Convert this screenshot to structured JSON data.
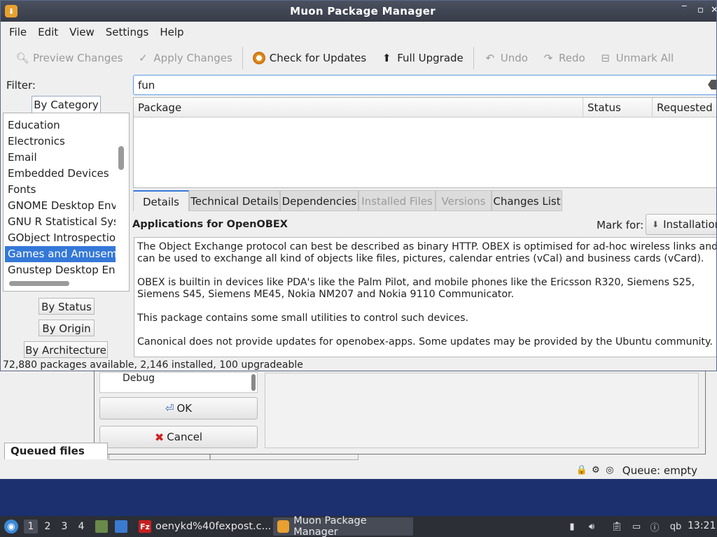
{
  "window": {
    "title": "Muon Package Manager",
    "controls": [
      "‾",
      "▫",
      "✕"
    ]
  },
  "menu": [
    "File",
    "Edit",
    "View",
    "Settings",
    "Help"
  ],
  "toolbar": {
    "preview": "Preview Changes",
    "apply": "Apply Changes",
    "check_updates": "Check for Updates",
    "full_upgrade": "Full Upgrade",
    "undo": "Undo",
    "redo": "Redo",
    "unmark_all": "Unmark All"
  },
  "filter": {
    "label": "Filter:",
    "by_category": "By Category",
    "by_status": "By Status",
    "by_origin": "By Origin",
    "by_architecture": "By Architecture",
    "categories": [
      "Education",
      "Electronics",
      "Email",
      "Embedded Devices",
      "Fonts",
      "GNOME Desktop Envir",
      "GNU R Statistical Syste",
      "GObject Introspection",
      "Games and Amusemen",
      "Gnustep Desktop Envir"
    ],
    "selected_category": "Games and Amusemen"
  },
  "search": {
    "value": "fun"
  },
  "table": {
    "columns": [
      "Package",
      "Status",
      "Requested"
    ]
  },
  "details": {
    "tabs": [
      "Details",
      "Technical Details",
      "Dependencies",
      "Installed Files",
      "Versions",
      "Changes List"
    ],
    "summary": "Applications for OpenOBEX",
    "mark_for_label": "Mark for:",
    "mark_for_value": "Installation",
    "description": [
      "The Object Exchange protocol can best be described as binary HTTP. OBEX is optimised for ad-hoc wireless links and can be used to exchange all kind of objects like files, pictures, calendar entries (vCal) and business cards (vCard).",
      "OBEX is builtin in devices like PDA's like the Palm Pilot, and mobile phones like the Ericsson R320, Siemens S25, Siemens S45, Siemens ME45, Nokia NM207 and Nokia 9110 Communicator.",
      "This package contains some small utilities to control such devices.",
      "Canonical does not provide updates for openobex-apps. Some updates may be provided by the Ubuntu community."
    ]
  },
  "statusbar": {
    "text": "72,880 packages available, 2,146 installed, 100 upgradeable"
  },
  "background_window": {
    "list_item": "Debug",
    "ok": "OK",
    "cancel": "Cancel",
    "queued_tab": "Queued files",
    "queue_status": "Queue: empty"
  },
  "taskbar": {
    "workspaces": [
      "1",
      "2",
      "3",
      "4"
    ],
    "task_filezilla": "oenykd%40fexpost.c...",
    "task_muon": "Muon Package Manager",
    "tray_qb": "qb",
    "clock": "13:21"
  }
}
